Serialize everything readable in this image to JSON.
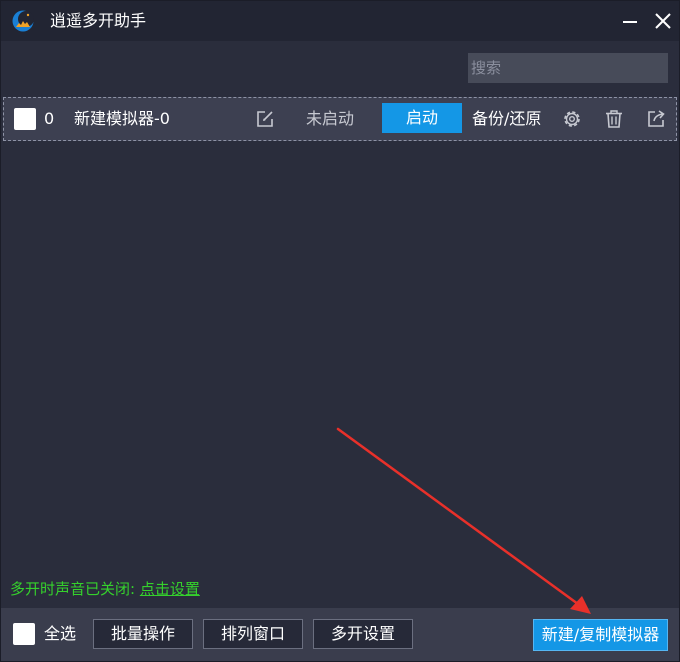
{
  "window": {
    "title": "逍遥多开助手"
  },
  "search": {
    "placeholder": "搜索",
    "value": ""
  },
  "emulators": [
    {
      "index": "0",
      "name": "新建模拟器-0",
      "status": "未启动",
      "start_label": "启动",
      "backup_label": "备份/还原"
    }
  ],
  "notice": {
    "text": "多开时声音已关闭: ",
    "link": "点击设置"
  },
  "footer": {
    "select_all_label": "全选",
    "batch_label": "批量操作",
    "arrange_label": "排列窗口",
    "multi_settings_label": "多开设置",
    "new_copy_label": "新建/复制模拟器"
  },
  "colors": {
    "background": "#2a2d3c",
    "titlebar": "#222533",
    "row_background": "#3d4051",
    "accent_blue": "#1497e6",
    "notice_green": "#35d12c",
    "annotation_red": "#e8302a"
  },
  "icons": {
    "logo": "moon-logo-icon",
    "minimize": "minimize-icon",
    "close": "close-icon",
    "edit": "edit-icon",
    "settings": "gear-icon",
    "delete": "trash-icon",
    "shortcut": "share-icon"
  }
}
